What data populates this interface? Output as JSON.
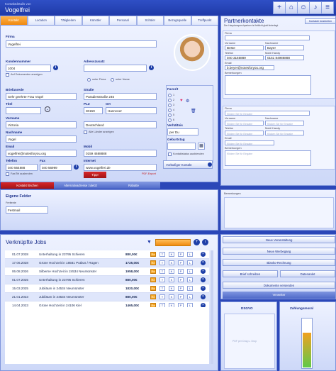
{
  "header": {
    "subtitle": "Kontaktdetails von",
    "title": "Vogelfrei"
  },
  "toolbar_icons": [
    "plus-icon",
    "home-icon",
    "person-icon",
    "music-icon",
    "menu-icon"
  ],
  "tabs": [
    "Kontakt",
    "Location",
    "Tätigkeiten",
    "Künstler",
    "Personal",
    "Schüler",
    "Bezugsquelle",
    "Treffpunkt"
  ],
  "contact": {
    "firma_label": "Firma",
    "firma": "Vogelfrei",
    "kundennummer_label": "Kundennummer",
    "kundennummer": "1004",
    "auf_dokumenten": "Auf Dokumenten anzeigen",
    "adresszusatz_label": "Adresszusatz",
    "unter_firma": "unter Firma",
    "unter_name": "unter Name",
    "briefanrede_label": "Briefanrede",
    "briefanrede": "Sehr geehrte Frau Vogel",
    "strasse_label": "Straße",
    "strasse": "Paradiesstraße 245",
    "titel_label": "Titel",
    "plz_label": "PLZ",
    "plz": "30159",
    "ort_label": "Ort",
    "ort": "Hannover",
    "vorname_label": "Vorname",
    "vorname": "Victoria",
    "land": "Deutschland",
    "nachname_label": "Nachname",
    "nachname": "Vogel",
    "alle_laender": "Alle Länder anzeigen",
    "email_label": "Email",
    "email": "vogelfrei@notesforyou.org",
    "mobil_label": "Mobil",
    "mobil": "0159 4688888",
    "telefon_label": "Telefon",
    "telefon": "040 564888",
    "fax_label": "Fax",
    "fax": "040 56999",
    "internet_label": "Internet",
    "internet": "www.vogelfrei.de",
    "fax_aus": "Fax/Tel auslenden",
    "tipp_btn": "Tipp!",
    "pdf_export": "PDF-Export",
    "favorit_label": "Favorit",
    "fav_options": [
      "1",
      "2",
      "3",
      "4",
      "5",
      "6"
    ],
    "verhaeltnis_label": "Verhältnis",
    "verhaeltnis": "per Du",
    "geburtstag_label": "Geburtstag",
    "kontaktstatus": "Kontaktstatus ausblenden",
    "vorlaeufiger": "Vorläufiger Kontakt"
  },
  "bottom_tabs": [
    "Kontakt löschen",
    "Alternativadresse zuletzt",
    "Rabatte"
  ],
  "eigene_felder": {
    "title": "Eigene Felder",
    "sub": "Freitexte",
    "value": "Festmail"
  },
  "partner": {
    "title": "Partnerkontakte",
    "desc": "Der Hauptansprechpartner ist fettlicht glatt hinterlegt",
    "btn": "Kontakte bearbeiten",
    "firma_label": "Firma",
    "vorname_label": "Vorname",
    "vorname": "Beste",
    "nachname_label": "Nachname",
    "nachname": "Bayer",
    "telefon_label": "Telefon",
    "telefon": "040 3165889",
    "mobil_label": "Mobil Handy",
    "mobil": "0151 84986888",
    "email_label": "Email",
    "email": "b.beyer@notesforyou.org",
    "bemerkung_label": "Bemerkungen",
    "placeholder": "Klicken Sie für Eingabe"
  },
  "bemerkungen": {
    "title": "Bemerkungen"
  },
  "jobs": {
    "title": "Verknüpfte Jobs",
    "rows": [
      {
        "date": "01.07.2028",
        "desc": "Unterhaltung in 23795  Schieren",
        "amount": "880,00€"
      },
      {
        "date": "17.06.2028",
        "desc": "Grüne Hochzeit in 18581  Putbus / Rügen",
        "amount": "1725,00€"
      },
      {
        "date": "06.08.2026",
        "desc": "Silberne Hochzeit in 24534  Neumünster",
        "amount": "1958,00€"
      },
      {
        "date": "01.07.2025",
        "desc": "Unterhaltung in 23795  Schieren",
        "amount": "880,00€"
      },
      {
        "date": "15.03.2025",
        "desc": "Jubiläum in 24534  Neumünster",
        "amount": "1820,00€"
      },
      {
        "date": "21.01.2023",
        "desc": "Jubiläum in 24534  Neumünster",
        "amount": "880,00€"
      },
      {
        "date": "14.04.2023",
        "desc": "Grüne Hochzeit in 24106  Kiel",
        "amount": "1465,00€"
      }
    ],
    "icons": [
      "Re",
      "T",
      "K",
      "P",
      "L"
    ]
  },
  "actions": [
    "Neue Veranstaltung",
    "Neue Werbegang",
    "Blanko-Rechnung",
    "Brief schreiben",
    "Datenanlet",
    "Dokumente versenden",
    "Verweiter"
  ],
  "dsgvo": {
    "title": "DSGVO",
    "hint": "PDF per Drag u. Drop"
  },
  "zahlungsmoral": {
    "title": "Zahlungsmoral",
    "level": 0.7
  },
  "colors": {
    "accent": "#2b47b8",
    "tab_active": "#f08a10",
    "red": "#c41c1f"
  }
}
